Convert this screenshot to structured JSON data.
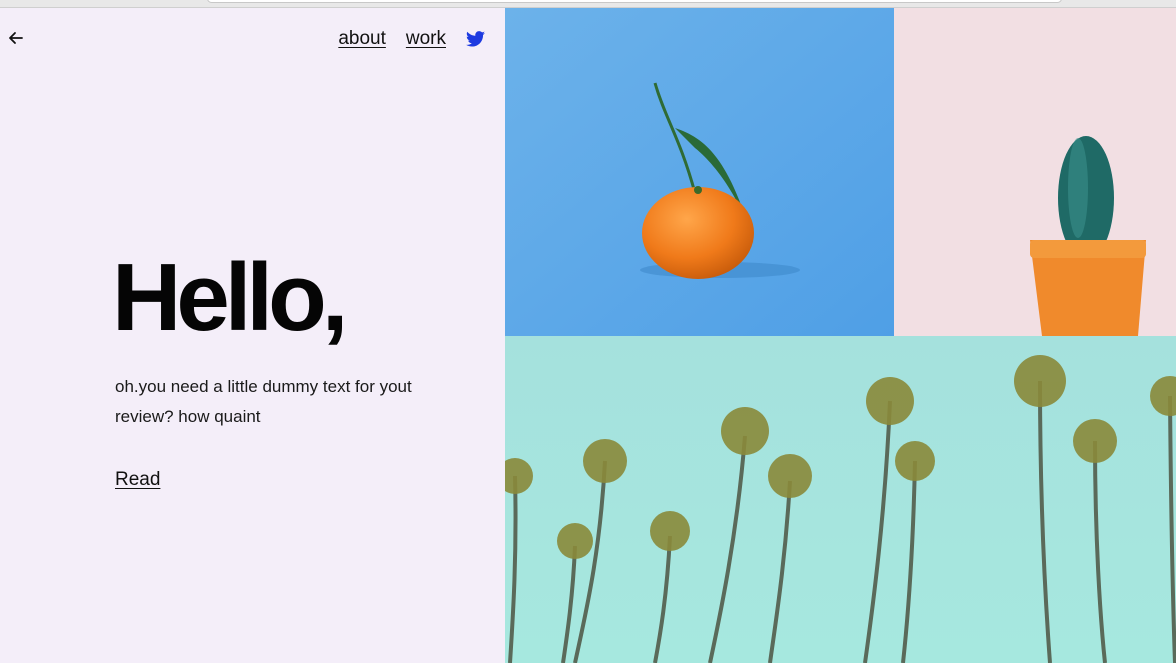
{
  "nav": {
    "about_label": "about",
    "work_label": "work",
    "twitter_icon": "twitter-icon",
    "back_icon": "arrow-left-icon"
  },
  "hero": {
    "title": "Hello,",
    "text": "oh.you need a little dummy text for yout review? how quaint",
    "read_label": "Read"
  },
  "images": {
    "orange_tile": "orange-photo",
    "cactus_tile": "cactus-photo",
    "palms_tile": "palm-trees-photo"
  },
  "colors": {
    "background": "#f4eef9",
    "text": "#111111",
    "twitter_blue": "#1d3ae0",
    "orange_bg": "#5aa9ec",
    "cactus_bg": "#f1dfe3",
    "palms_sky": "#a8e4dc"
  }
}
